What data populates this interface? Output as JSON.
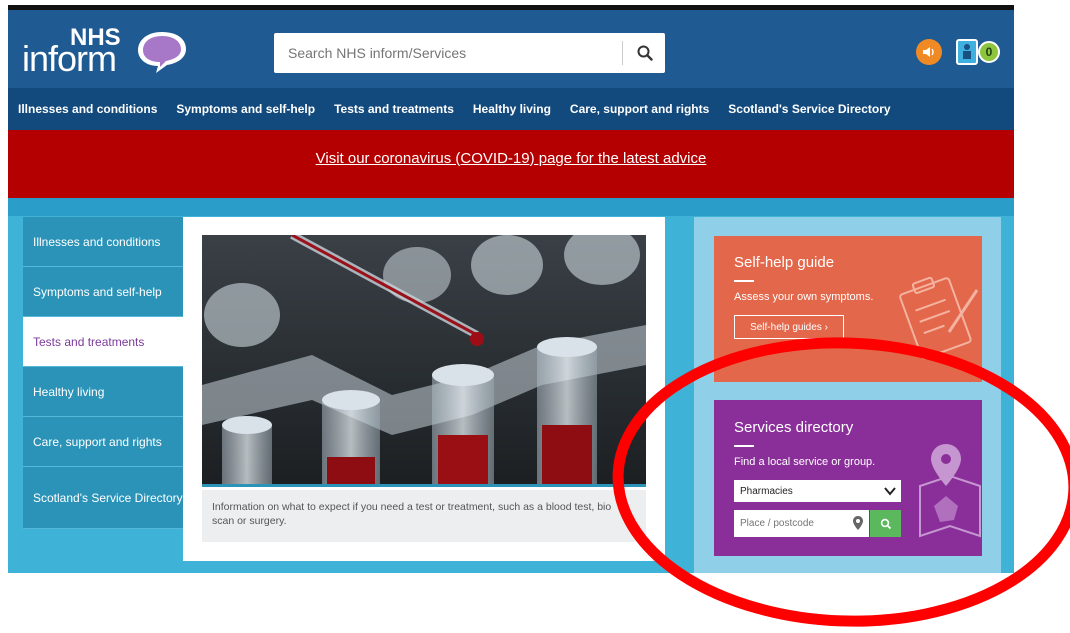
{
  "header": {
    "logo_nhs": "NHS",
    "logo_inform": "inform",
    "search_placeholder": "Search NHS inform/Services",
    "accessibility_count": "0"
  },
  "nav": {
    "items": [
      "Illnesses and conditions",
      "Symptoms and self-help",
      "Tests and treatments",
      "Healthy living",
      "Care, support and rights",
      "Scotland's Service Directory"
    ]
  },
  "banner": {
    "link_text": "Visit our coronavirus (COVID-19) page for the latest advice",
    "color": "#b40000"
  },
  "sidebar": {
    "items": [
      {
        "label": "Illnesses and conditions",
        "active": false
      },
      {
        "label": "Symptoms and self-help",
        "active": false
      },
      {
        "label": "Tests and treatments",
        "active": true
      },
      {
        "label": "Healthy living",
        "active": false
      },
      {
        "label": "Care, support and rights",
        "active": false
      },
      {
        "label": "Scotland's Service Directory",
        "active": false
      }
    ]
  },
  "main": {
    "caption": "Information on what to expect if you need a test or treatment, such as a blood test, bio scan or surgery."
  },
  "selfhelp": {
    "title": "Self-help guide",
    "description": "Assess your own symptoms.",
    "button_label": "Self-help guides  ›",
    "color": "#e3674a"
  },
  "services": {
    "title": "Services directory",
    "description": "Find a local service or group.",
    "select_value": "Pharmacies",
    "place_placeholder": "Place / postcode",
    "color": "#8a2f99"
  },
  "icons": [
    "search-icon",
    "speaker-icon",
    "accessibility-icon",
    "clipboard-icon",
    "map-pin-icon",
    "chevron-down-icon"
  ],
  "annotation": {
    "color": "#ff0000"
  }
}
